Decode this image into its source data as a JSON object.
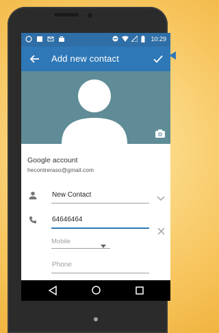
{
  "status_bar": {
    "time": "10:29",
    "icons_left": [
      "whatsapp-icon",
      "image-icon",
      "mail-icon",
      "briefcase-icon"
    ],
    "icons_right": [
      "minus-circle-icon",
      "wifi-icon",
      "signal-icon",
      "battery-icon"
    ]
  },
  "app_bar": {
    "title": "Add new contact",
    "back_icon": "arrow-left-icon",
    "save_icon": "check-icon"
  },
  "photo": {
    "avatar_icon": "person-silhouette-icon",
    "camera_icon": "camera-icon"
  },
  "account": {
    "title": "Google account",
    "email": "hecontreraso@gmail.com"
  },
  "name_field": {
    "value": "New Contact",
    "expand_icon": "chevron-down-icon"
  },
  "phone_field": {
    "value": "64646464",
    "clear_icon": "close-icon",
    "type_label": "Mobile",
    "next_placeholder": "Phone"
  },
  "nav_bar": {
    "icons": [
      "nav-back-icon",
      "nav-home-icon",
      "nav-recents-icon"
    ]
  },
  "colors": {
    "primary_dark": "#2f6ea6",
    "primary": "#2f78b7",
    "photo_bg": "#5f8c96",
    "background": "#f7c45c"
  }
}
